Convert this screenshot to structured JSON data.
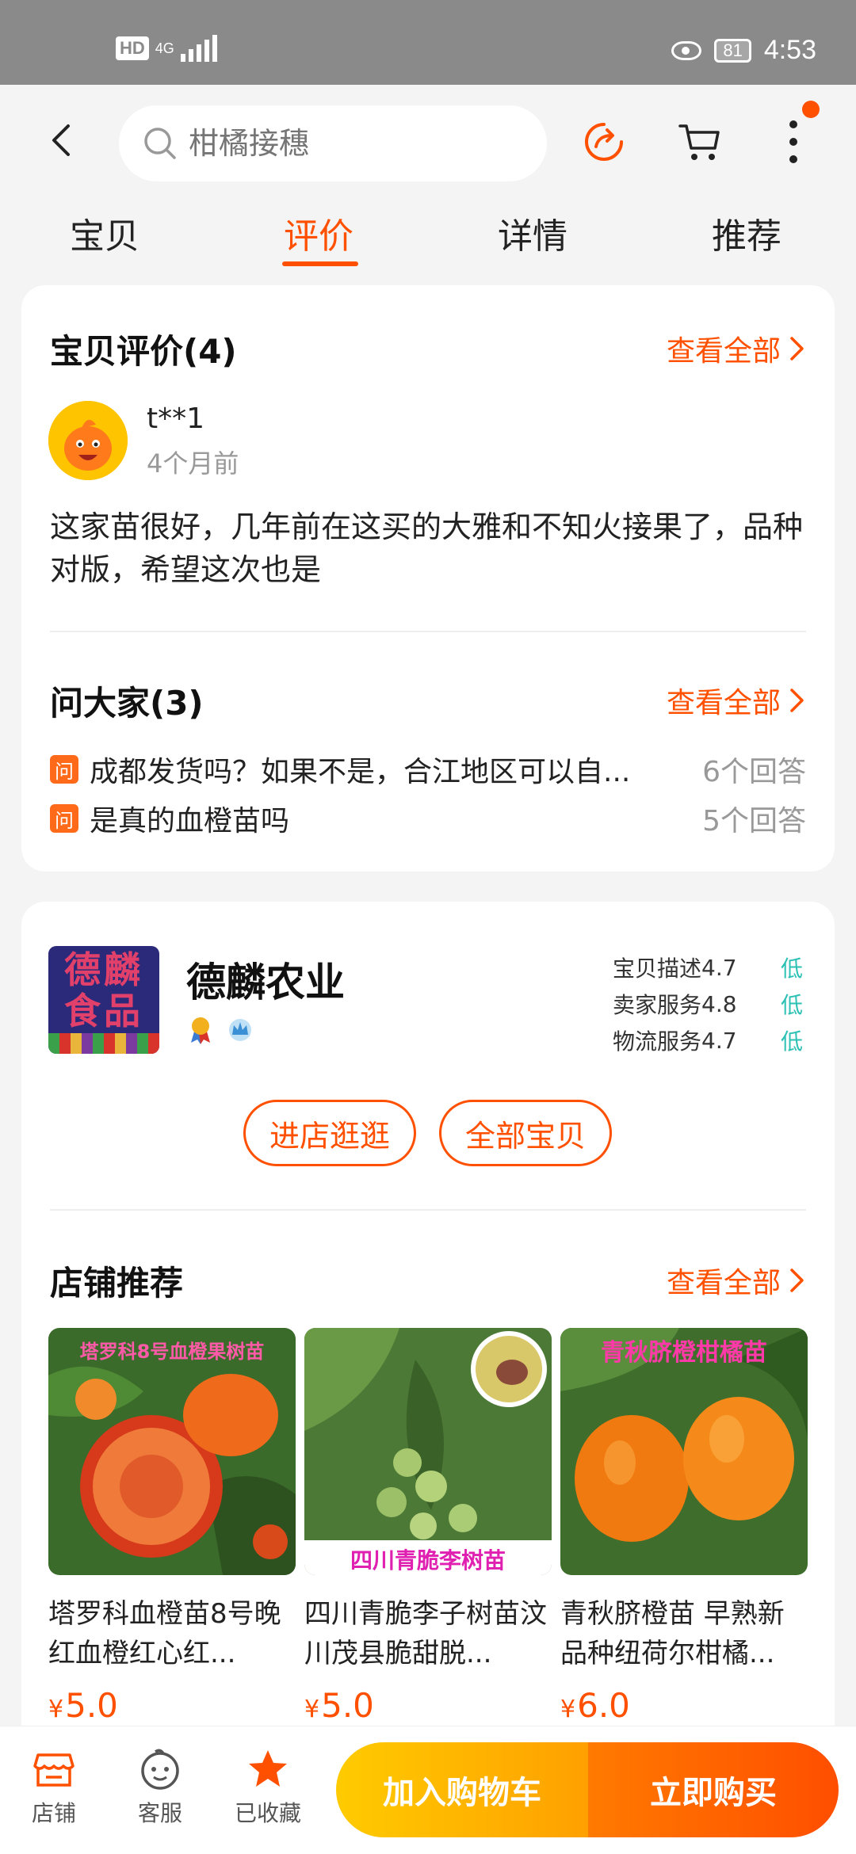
{
  "status_bar": {
    "hd": "HD",
    "network": "4G",
    "battery": "81",
    "time": "4:53"
  },
  "search": {
    "placeholder": "柑橘接穗"
  },
  "tabs": [
    "宝贝",
    "评价",
    "详情",
    "推荐"
  ],
  "active_tab": "评价",
  "reviews": {
    "title": "宝贝评价(4)",
    "see_all": "查看全部",
    "reviewer": "t**1",
    "time": "4个月前",
    "text": "这家苗很好，几年前在这买的大雅和不知火接果了，品种对版，希望这次也是"
  },
  "qa": {
    "title": "问大家(3)",
    "see_all": "查看全部",
    "badge": "问",
    "items": [
      {
        "question": "成都发货吗？如果不是，合江地区可以自...",
        "answers": "6个回答"
      },
      {
        "question": "是真的血橙苗吗",
        "answers": "5个回答"
      }
    ]
  },
  "shop": {
    "logo_text": "德麟食品",
    "name": "德麟农业",
    "ratings": [
      {
        "label": "宝贝描述",
        "score": "4.7",
        "level": "低"
      },
      {
        "label": "卖家服务",
        "score": "4.8",
        "level": "低"
      },
      {
        "label": "物流服务",
        "score": "4.7",
        "level": "低"
      }
    ],
    "enter_button": "进店逛逛",
    "all_button": "全部宝贝"
  },
  "recommend": {
    "title": "店铺推荐",
    "see_all": "查看全部",
    "products": [
      {
        "image_caption": "塔罗科8号血橙果树苗",
        "title": "塔罗科血橙苗8号晚红血橙红心红...",
        "currency": "¥",
        "price": "5.0"
      },
      {
        "image_caption": "四川青脆李树苗",
        "title": "四川青脆李子树苗汶川茂县脆甜脱...",
        "currency": "¥",
        "price": "5.0"
      },
      {
        "image_caption": "青秋脐橙柑橘苗",
        "title": "青秋脐橙苗 早熟新品种纽荷尔柑橘...",
        "currency": "¥",
        "price": "6.0"
      }
    ]
  },
  "bottom_bar": {
    "store": "店铺",
    "service": "客服",
    "favorited": "已收藏",
    "add_to_cart": "加入购物车",
    "buy_now": "立即购买"
  },
  "colors": {
    "accent": "#ff5000",
    "good_level": "#2cc1b4"
  }
}
